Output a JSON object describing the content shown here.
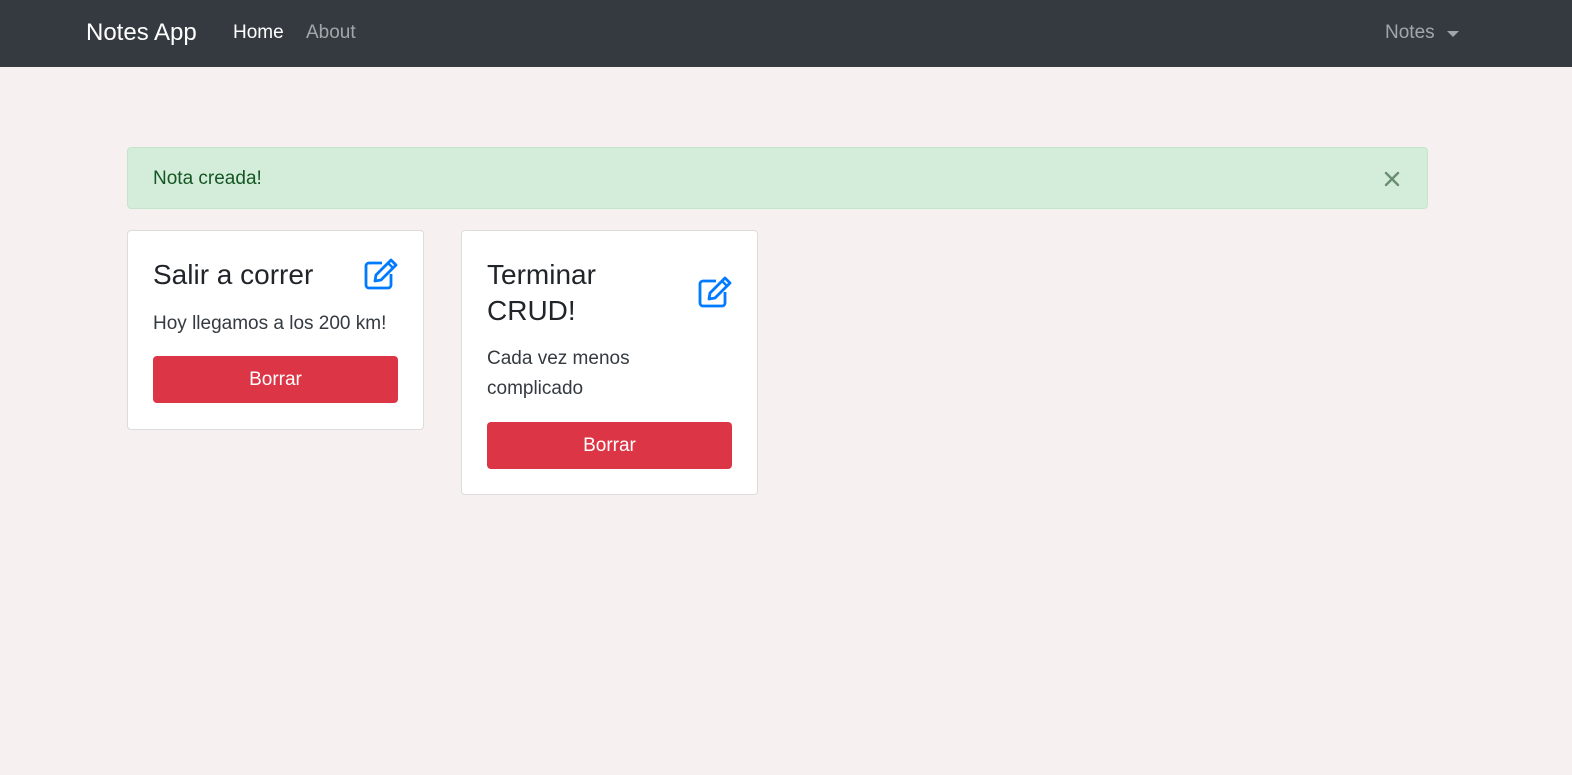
{
  "navbar": {
    "brand": "Notes App",
    "links": [
      {
        "label": "Home",
        "active": true
      },
      {
        "label": "About",
        "active": false
      }
    ],
    "dropdown": {
      "label": "Notes"
    }
  },
  "alert": {
    "message": "Nota creada!",
    "close_icon": "close-icon",
    "type": "success"
  },
  "notes": [
    {
      "title_lines": [
        "Salir a correr"
      ],
      "text_lines": [
        "Hoy llegamos a los 200 km!"
      ],
      "delete_label": "Borrar",
      "edit_icon": "edit-icon"
    },
    {
      "title_lines": [
        "Terminar",
        "CRUD!"
      ],
      "text_lines": [
        "Cada vez menos",
        "complicado"
      ],
      "delete_label": "Borrar",
      "edit_icon": "edit-icon"
    }
  ],
  "colors": {
    "navbar": "#343a40",
    "background": "#f6f1f0",
    "alert_bg": "#d4edda",
    "alert_text": "#155724",
    "danger": "#dc3545",
    "accent": "#007bff"
  }
}
